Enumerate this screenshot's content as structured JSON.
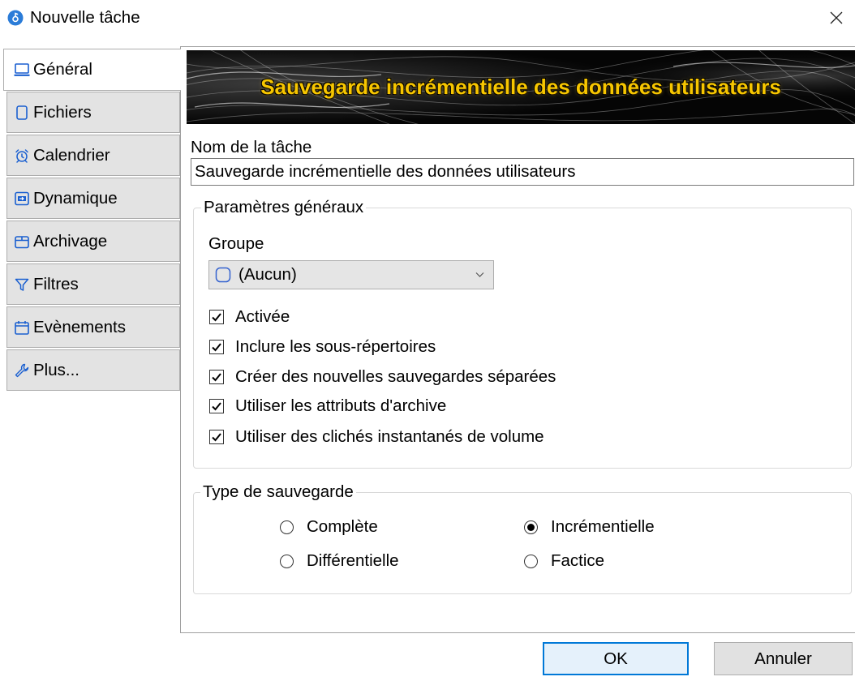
{
  "window": {
    "title": "Nouvelle tâche",
    "app_icon": "app-logo-icon",
    "close_icon": "close-icon"
  },
  "tabs": [
    {
      "label": "Général",
      "icon": "monitor-icon",
      "selected": true
    },
    {
      "label": "Fichiers",
      "icon": "file-icon",
      "selected": false
    },
    {
      "label": "Calendrier",
      "icon": "alarm-clock-icon",
      "selected": false
    },
    {
      "label": "Dynamique",
      "icon": "dynamic-icon",
      "selected": false
    },
    {
      "label": "Archivage",
      "icon": "archive-box-icon",
      "selected": false
    },
    {
      "label": "Filtres",
      "icon": "filter-icon",
      "selected": false
    },
    {
      "label": "Evènements",
      "icon": "calendar-icon",
      "selected": false
    },
    {
      "label": "Plus...",
      "icon": "wrench-icon",
      "selected": false
    }
  ],
  "banner": {
    "title": "Sauvegarde incrémentielle des données utilisateurs"
  },
  "task_name": {
    "label": "Nom de la tâche",
    "value": "Sauvegarde incrémentielle des données utilisateurs"
  },
  "general": {
    "legend": "Paramètres généraux",
    "group_label": "Groupe",
    "group": {
      "value": "(Aucun)",
      "icon": "group-color-icon",
      "dropdown_icon": "chevron-down-icon"
    },
    "options": [
      {
        "label": "Activée",
        "checked": true
      },
      {
        "label": "Inclure les sous-répertoires",
        "checked": true
      },
      {
        "label": "Créer des nouvelles sauvegardes séparées",
        "checked": true
      },
      {
        "label": "Utiliser les attributs d'archive",
        "checked": true
      },
      {
        "label": "Utiliser des clichés instantanés de volume",
        "checked": true
      }
    ]
  },
  "backup_type": {
    "legend": "Type de sauvegarde",
    "options": [
      {
        "label": "Complète",
        "selected": false
      },
      {
        "label": "Incrémentielle",
        "selected": true
      },
      {
        "label": "Différentielle",
        "selected": false
      },
      {
        "label": "Factice",
        "selected": false
      }
    ]
  },
  "buttons": {
    "ok": "OK",
    "cancel": "Annuler"
  },
  "colors": {
    "accent": "#0078d7",
    "icon_blue": "#1a5fd0",
    "banner_text": "#f7c600",
    "tab_background": "#e3e3e3",
    "default_button_background": "#e5f1fb"
  }
}
